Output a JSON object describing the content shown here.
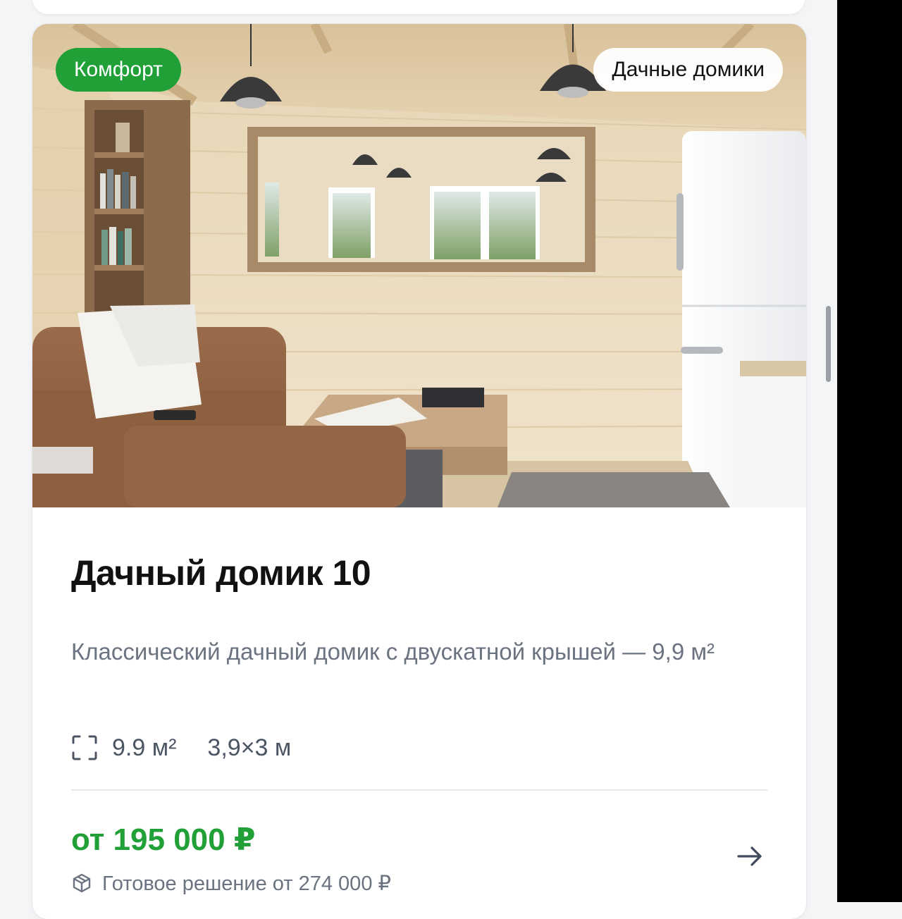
{
  "card": {
    "badge_tier": "Комфорт",
    "badge_category": "Дачные домики",
    "title": "Дачный домик 10",
    "description": "Классический дачный домик с двускатной крышей — 9,9 м²",
    "specs": {
      "area": "9.9 м²",
      "dimensions": "3,9×3 м"
    },
    "price": "от 195 000 ₽",
    "ready_solution": "Готовое решение от 274 000 ₽",
    "icons": {
      "area": "area-frame-icon",
      "box": "box-icon",
      "arrow": "arrow-right-icon"
    }
  },
  "colors": {
    "accent_green": "#21a038",
    "title": "#111111",
    "muted": "#6b7280"
  }
}
